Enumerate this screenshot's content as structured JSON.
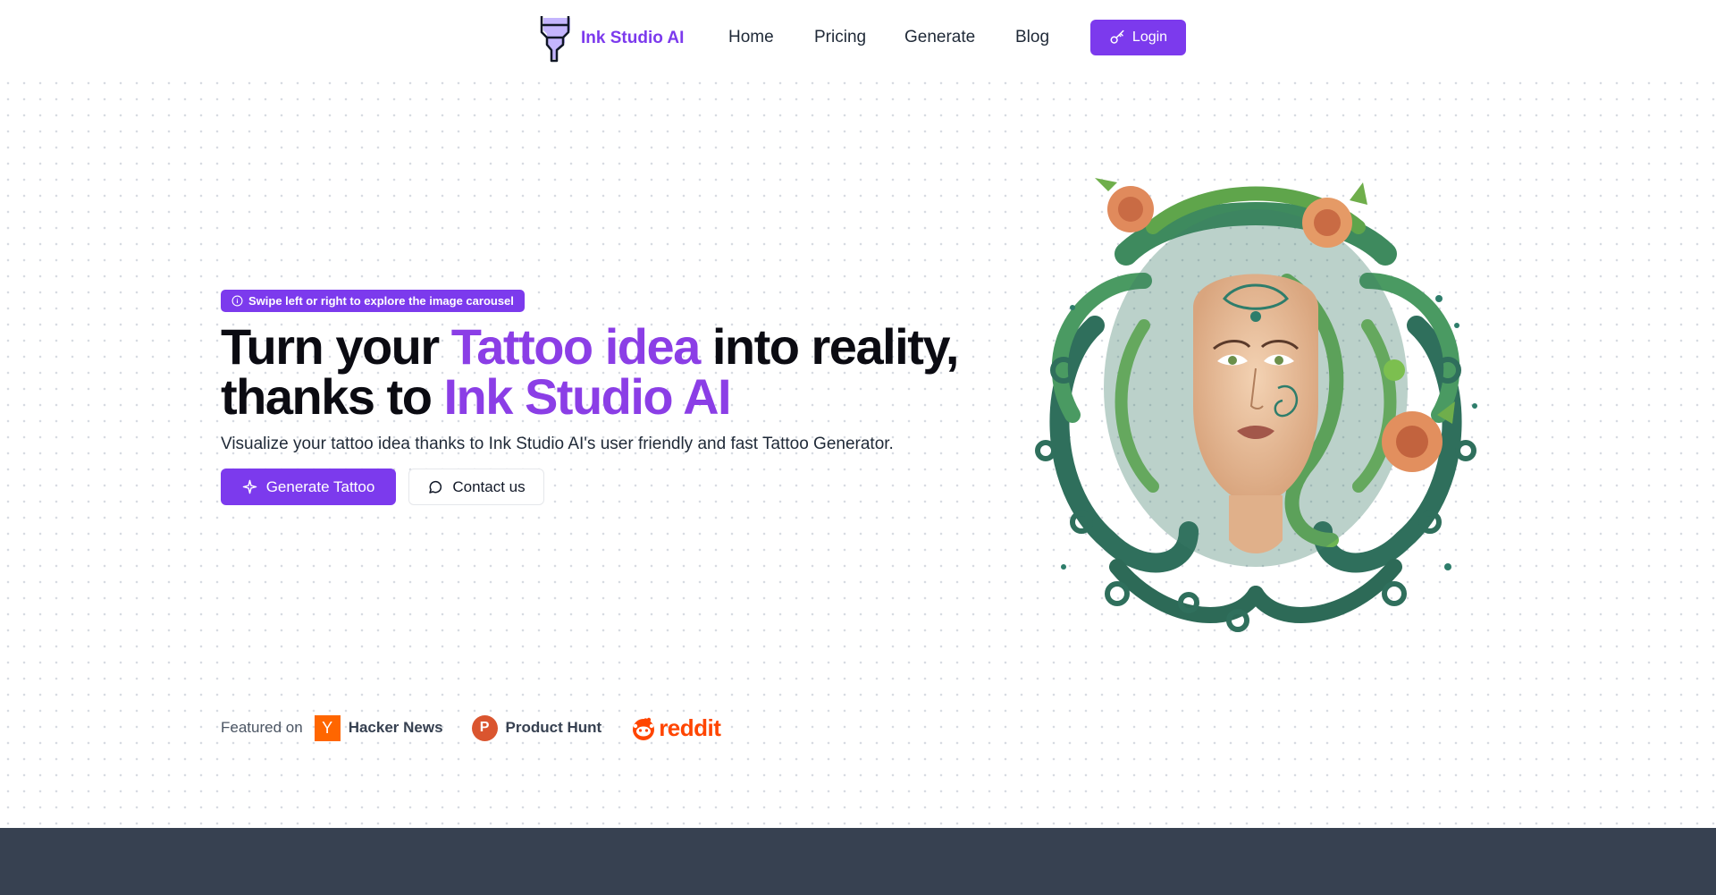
{
  "brand": {
    "name": "Ink Studio AI"
  },
  "nav": {
    "links": [
      {
        "label": "Home"
      },
      {
        "label": "Pricing"
      },
      {
        "label": "Generate"
      },
      {
        "label": "Blog"
      }
    ],
    "login_label": "Login"
  },
  "hero": {
    "badge": "Swipe left or right to explore the image carousel",
    "headline": {
      "part1": "Turn your ",
      "accent1": "Tattoo idea",
      "part2": " into reality, thanks to ",
      "accent2": "Ink Studio AI"
    },
    "subtext": "Visualize your tattoo idea thanks to Ink Studio AI's user friendly and fast Tattoo Generator.",
    "primary_cta": "Generate Tattoo",
    "secondary_cta": "Contact us",
    "image_icon": "medusa-tattoo-illustration"
  },
  "featured": {
    "label": "Featured on",
    "items": [
      {
        "name": "Hacker News",
        "logo_letter": "Y",
        "icon": "hacker-news-icon"
      },
      {
        "name": "Product Hunt",
        "logo_letter": "P",
        "icon": "product-hunt-icon"
      },
      {
        "name": "reddit",
        "icon": "reddit-icon"
      }
    ]
  },
  "colors": {
    "accent": "#7c3aed",
    "headline_accent": "#8b3ee6",
    "footer_band": "#374151"
  }
}
